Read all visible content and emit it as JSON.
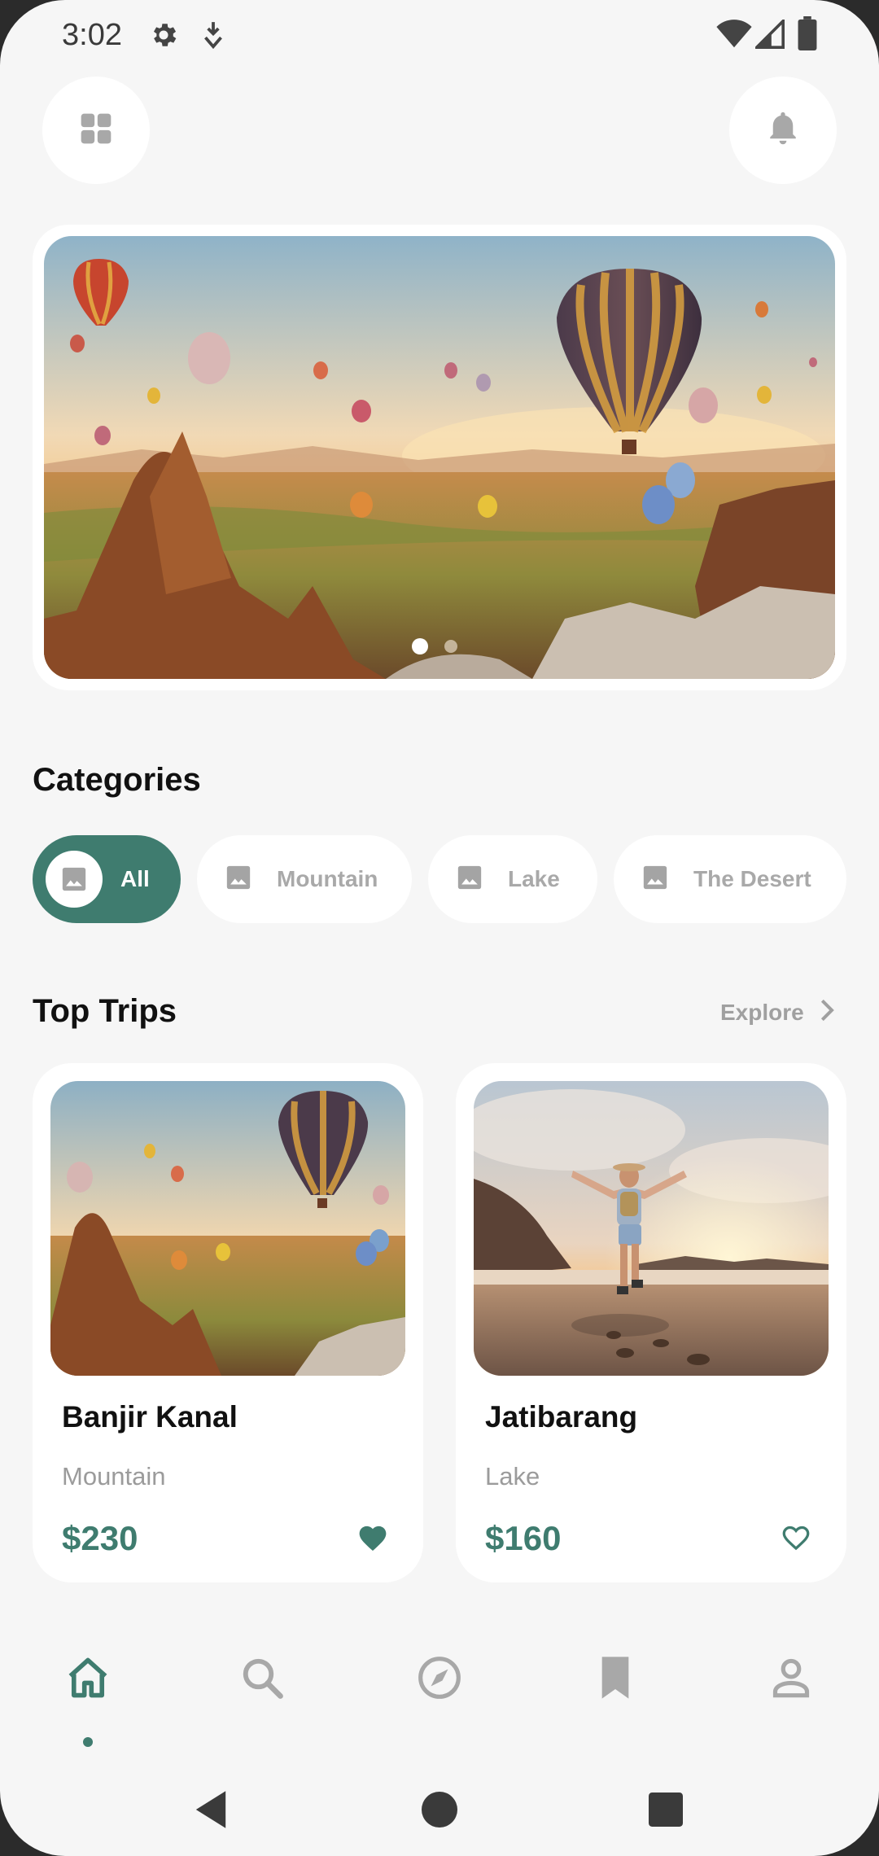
{
  "status_bar": {
    "time": "3:02",
    "icons": [
      "settings-icon",
      "download-shield-icon",
      "wifi-icon",
      "signal-icon",
      "battery-icon"
    ]
  },
  "header": {
    "left_button_icon": "grid-icon",
    "right_button_icon": "bell-icon"
  },
  "hero": {
    "image": "hot-air-balloons-over-rock-valley",
    "pagination": {
      "active": 1,
      "total": 2
    }
  },
  "categories": {
    "title": "Categories",
    "items": [
      {
        "label": "All",
        "icon": "image-icon",
        "active": true
      },
      {
        "label": "Mountain",
        "icon": "image-icon",
        "active": false
      },
      {
        "label": "Lake",
        "icon": "image-icon",
        "active": false
      },
      {
        "label": "The Desert",
        "icon": "image-icon",
        "active": false
      }
    ]
  },
  "top_trips": {
    "title": "Top Trips",
    "explore_label": "Explore",
    "items": [
      {
        "name": "Banjir Kanal",
        "category": "Mountain",
        "price": "$230",
        "favorite": true,
        "image": "hot-air-balloons"
      },
      {
        "name": "Jatibarang",
        "category": "Lake",
        "price": "$160",
        "favorite": false,
        "image": "traveler-on-beach-at-sunset"
      }
    ]
  },
  "bottom_nav": {
    "items": [
      "home-icon",
      "search-icon",
      "compass-icon",
      "bookmark-icon",
      "profile-icon"
    ],
    "active": "home-icon"
  },
  "system_nav": [
    "back-icon",
    "home-circle-icon",
    "recents-icon"
  ],
  "colors": {
    "accent": "#3f7c6f",
    "background": "#f6f6f6",
    "card": "#ffffff",
    "muted_text": "#9b9b9b"
  }
}
